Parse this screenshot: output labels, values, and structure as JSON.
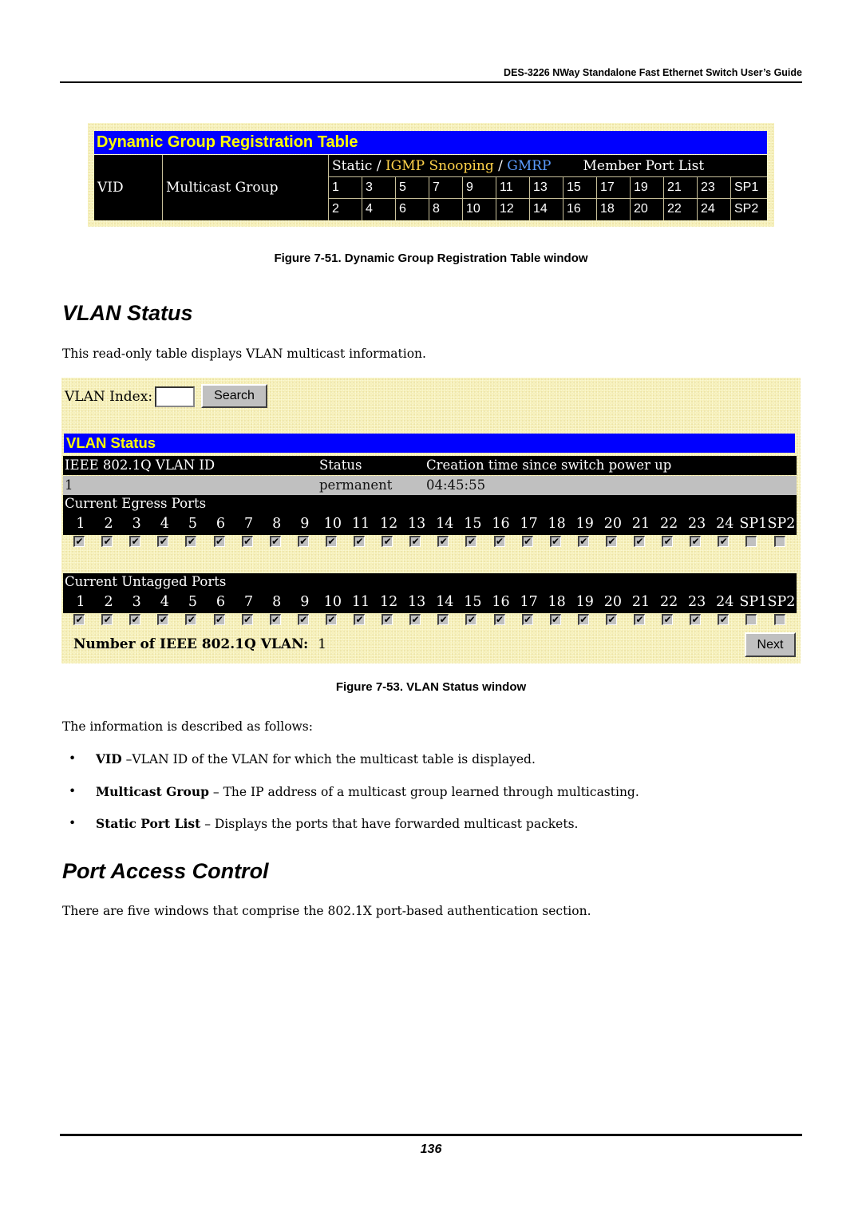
{
  "header": {
    "guide_title": "DES-3226 NWay Standalone Fast Ethernet Switch User’s Guide"
  },
  "figure51": {
    "panel_title": "Dynamic Group Registration Table",
    "col_vid": "VID",
    "col_multicast_group": "Multicast Group",
    "hdr_static": "Static / ",
    "hdr_igmp": "IGMP Snooping",
    "hdr_sep": " / ",
    "hdr_gmrp": "GMRP",
    "hdr_member_port_list": "Member Port List",
    "ports_row1": [
      "1",
      "3",
      "5",
      "7",
      "9",
      "11",
      "13",
      "15",
      "17",
      "19",
      "21",
      "23",
      "SP1"
    ],
    "ports_row2": [
      "2",
      "4",
      "6",
      "8",
      "10",
      "12",
      "14",
      "16",
      "18",
      "20",
      "22",
      "24",
      "SP2"
    ],
    "caption": "Figure 7-51.  Dynamic Group Registration Table window"
  },
  "vlan_status_section": {
    "title": "VLAN Status",
    "intro": "This read-only table displays VLAN multicast information."
  },
  "figure53": {
    "vlan_index_label": "VLAN Index:",
    "vlan_index_value": "",
    "search_button": "Search",
    "panel_title": "VLAN Status",
    "table_headers": [
      "IEEE 802.1Q VLAN ID",
      "Status",
      "Creation time since switch power up"
    ],
    "table_row": [
      "1",
      "permanent",
      "04:45:55"
    ],
    "egress_title": "Current Egress Ports",
    "untagged_title": "Current Untagged Ports",
    "port_labels": [
      "1",
      "2",
      "3",
      "4",
      "5",
      "6",
      "7",
      "8",
      "9",
      "10",
      "11",
      "12",
      "13",
      "14",
      "15",
      "16",
      "17",
      "18",
      "19",
      "20",
      "21",
      "22",
      "23",
      "24",
      "SP1",
      "SP2"
    ],
    "egress_checked": [
      true,
      true,
      true,
      true,
      true,
      true,
      true,
      true,
      true,
      true,
      true,
      true,
      true,
      true,
      true,
      true,
      true,
      true,
      true,
      true,
      true,
      true,
      true,
      true,
      false,
      false
    ],
    "untagged_checked": [
      true,
      true,
      true,
      true,
      true,
      true,
      true,
      true,
      true,
      true,
      true,
      true,
      true,
      true,
      true,
      true,
      true,
      true,
      true,
      true,
      true,
      true,
      true,
      true,
      false,
      false
    ],
    "num_vlan_label": "Number of IEEE 802.1Q VLAN:",
    "num_vlan_value": "1",
    "next_button": "Next",
    "caption": "Figure 7-53.  VLAN Status window"
  },
  "description": {
    "intro": "The information is described as follows:",
    "items": [
      {
        "term": "VID",
        "text": " –VLAN ID of the VLAN for which the multicast table is displayed."
      },
      {
        "term": "Multicast Group",
        "text": " – The IP address of a multicast group learned through multicasting."
      },
      {
        "term": "Static Port List",
        "text": " – Displays the ports that have forwarded multicast packets."
      }
    ],
    "bullet_glyph": "•"
  },
  "port_access_section": {
    "title": "Port Access Control",
    "intro": "There are five windows that comprise the 802.1X port-based authentication section."
  },
  "footer": {
    "page_number": "136"
  }
}
